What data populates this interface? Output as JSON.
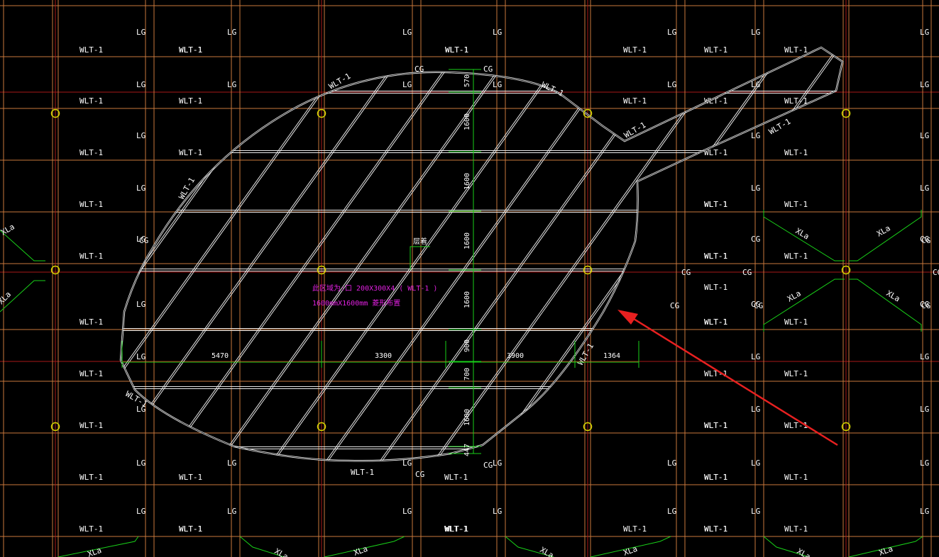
{
  "colors": {
    "background": "#000000",
    "grid_orange": "#c8783c",
    "grid_red": "#a81818",
    "wall_white": "#e8e8e8",
    "label_white": "#ffffff",
    "dimension_green": "#19d119",
    "column_yellow": "#d8d800",
    "annotation_magenta": "#e020e0",
    "arrow_red": "#e82020"
  },
  "drawing": {
    "block_labels": {
      "LG": "LG",
      "CG": "CG",
      "WLT": "WLT-1",
      "XL": "XLa"
    },
    "dimensions": {
      "horizontal": [
        "5470",
        "3300",
        "3900",
        "1364"
      ],
      "vertical": [
        "570",
        "1600",
        "1600",
        "1600",
        "1600",
        "900",
        "700",
        "1600",
        "447"
      ]
    },
    "marker_label": "层着",
    "annotation_lines": [
      "此区域为:口   200X300X4   ( WLT-1  )",
      "1600mmX1600mm   菱形布置"
    ],
    "paddle_wall_labels": [
      "WLT-1",
      "WLT-1",
      "WLT-1",
      "WLT-1",
      "WLT-1",
      "WLT-1",
      "WLT-1",
      "WLT-1"
    ]
  }
}
